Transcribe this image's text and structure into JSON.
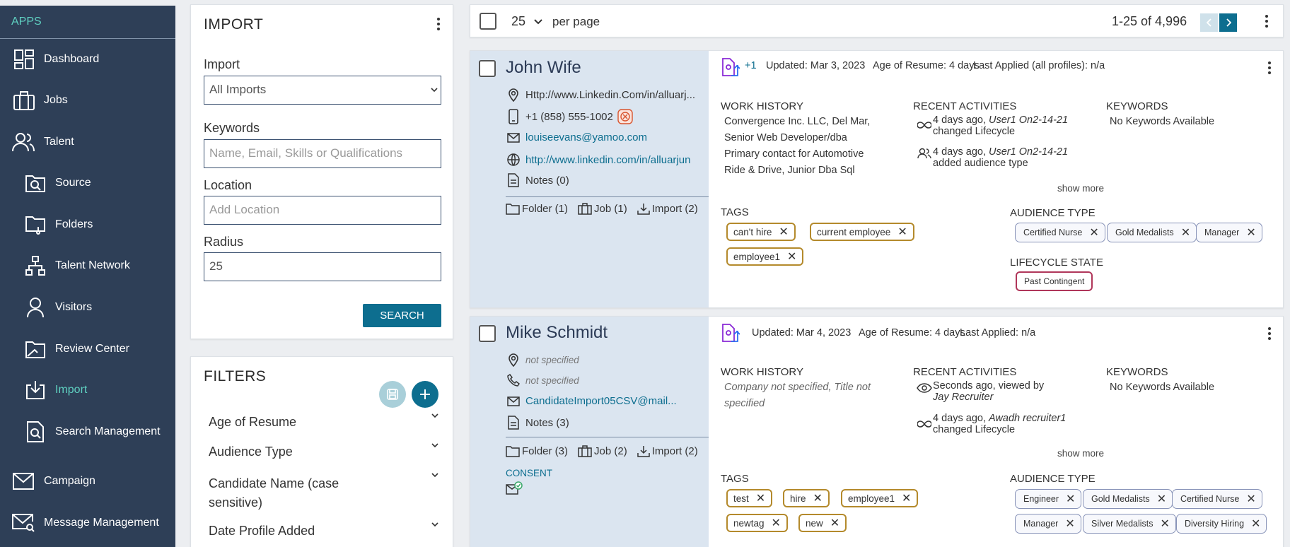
{
  "sidebar": {
    "apps_label": "APPS",
    "items": [
      {
        "label": "Dashboard",
        "icon": "dashboard-icon"
      },
      {
        "label": "Jobs",
        "icon": "briefcase-icon"
      },
      {
        "label": "Talent",
        "icon": "people-icon"
      },
      {
        "label": "Source",
        "icon": "folder-search-icon"
      },
      {
        "label": "Folders",
        "icon": "folder-icon"
      },
      {
        "label": "Talent Network",
        "icon": "network-icon"
      },
      {
        "label": "Visitors",
        "icon": "person-icon"
      },
      {
        "label": "Review Center",
        "icon": "review-folder-icon"
      },
      {
        "label": "Import",
        "icon": "import-icon",
        "active": true
      },
      {
        "label": "Search Management",
        "icon": "document-search-icon"
      },
      {
        "label": "Campaign",
        "icon": "mail-icon"
      },
      {
        "label": "Message Management",
        "icon": "mail-search-icon"
      }
    ]
  },
  "import_panel": {
    "title": "IMPORT",
    "import_label": "Import",
    "import_value": "All Imports",
    "keywords_label": "Keywords",
    "keywords_placeholder": "Name, Email, Skills or Qualifications",
    "location_label": "Location",
    "location_placeholder": "Add Location",
    "radius_label": "Radius",
    "radius_value": "25",
    "search_button": "SEARCH"
  },
  "filters_panel": {
    "title": "FILTERS",
    "items": [
      "Age of Resume",
      "Audience Type",
      "Candidate Name (case sensitive)",
      "Date Profile Added"
    ]
  },
  "topbar": {
    "per_page_value": "25",
    "per_page_label": "per page",
    "range": "1-25 of 4,996"
  },
  "candidates": [
    {
      "name": "John Wife",
      "location": "Http://www.Linkedin.Com/in/alluarj...",
      "phone": "+1 (858) 555-1002",
      "email": "louiseevans@yamoo.com",
      "website": "http://www.linkedin.com/in/alluarjun",
      "notes": "Notes (0)",
      "folder": "Folder (1)",
      "job": "Job (1)",
      "import": "Import (2)",
      "plus": "+1",
      "updated": "Updated: Mar 3, 2023",
      "age": "Age of Resume: 4 days",
      "last_applied": "Last Applied (all profiles): n/a",
      "work_history_title": "WORK HISTORY",
      "work_history": [
        "Convergence Inc. LLC, Del Mar,",
        "Senior Web Developer/dba",
        "Primary contact for Automotive",
        "Ride & Drive, Junior Dba Sql"
      ],
      "activities_title": "RECENT ACTIVITIES",
      "activities": [
        {
          "time": "4 days ago,",
          "user": "User1 On2-14-21",
          "action": "changed Lifecycle"
        },
        {
          "time": "4 days ago,",
          "user": "User1 On2-14-21",
          "action": "added audience type"
        }
      ],
      "keywords_title": "KEYWORDS",
      "keywords": "No Keywords Available",
      "show_more": "show more",
      "tags_title": "TAGS",
      "tags": [
        "can't hire",
        "current employee",
        "employee1"
      ],
      "audience_title": "AUDIENCE TYPE",
      "audience": [
        "Certified Nurse",
        "Gold Medalists",
        "Manager"
      ],
      "lifecycle_title": "LIFECYCLE STATE",
      "lifecycle": "Past Contingent"
    },
    {
      "name": "Mike Schmidt",
      "location": "not specified",
      "phone": "not specified",
      "email": "CandidateImport05CSV@mail...",
      "notes": "Notes (3)",
      "folder": "Folder (3)",
      "job": "Job (2)",
      "import": "Import (2)",
      "consent": "CONSENT",
      "updated": "Updated: Mar 4, 2023",
      "age": "Age of Resume: 4 days",
      "last_applied": "Last Applied: n/a",
      "work_history_title": "WORK HISTORY",
      "work_history": [
        "Company not specified, Title not",
        "specified"
      ],
      "activities_title": "RECENT ACTIVITIES",
      "activities": [
        {
          "time": "Seconds ago, viewed by",
          "user": "Jay Recruiter",
          "action": ""
        },
        {
          "time": "4 days ago,",
          "user": "Awadh recruiter1",
          "action": "changed Lifecycle"
        }
      ],
      "keywords_title": "KEYWORDS",
      "keywords": "No Keywords Available",
      "show_more": "show more",
      "tags_title": "TAGS",
      "tags": [
        "test",
        "hire",
        "employee1",
        "newtag",
        "new"
      ],
      "audience_title": "AUDIENCE TYPE",
      "audience": [
        "Engineer",
        "Gold Medalists",
        "Certified Nurse",
        "Manager",
        "Silver Medalists",
        "Diversity Hiring"
      ]
    }
  ],
  "colors": {
    "sidebar": "#2e3f57",
    "accent": "#5fd0c1",
    "button": "#0d6e8f",
    "tag_border": "#b48a2c",
    "lifecycle_border": "#b0365a",
    "card_left": "#dbe5f0"
  }
}
